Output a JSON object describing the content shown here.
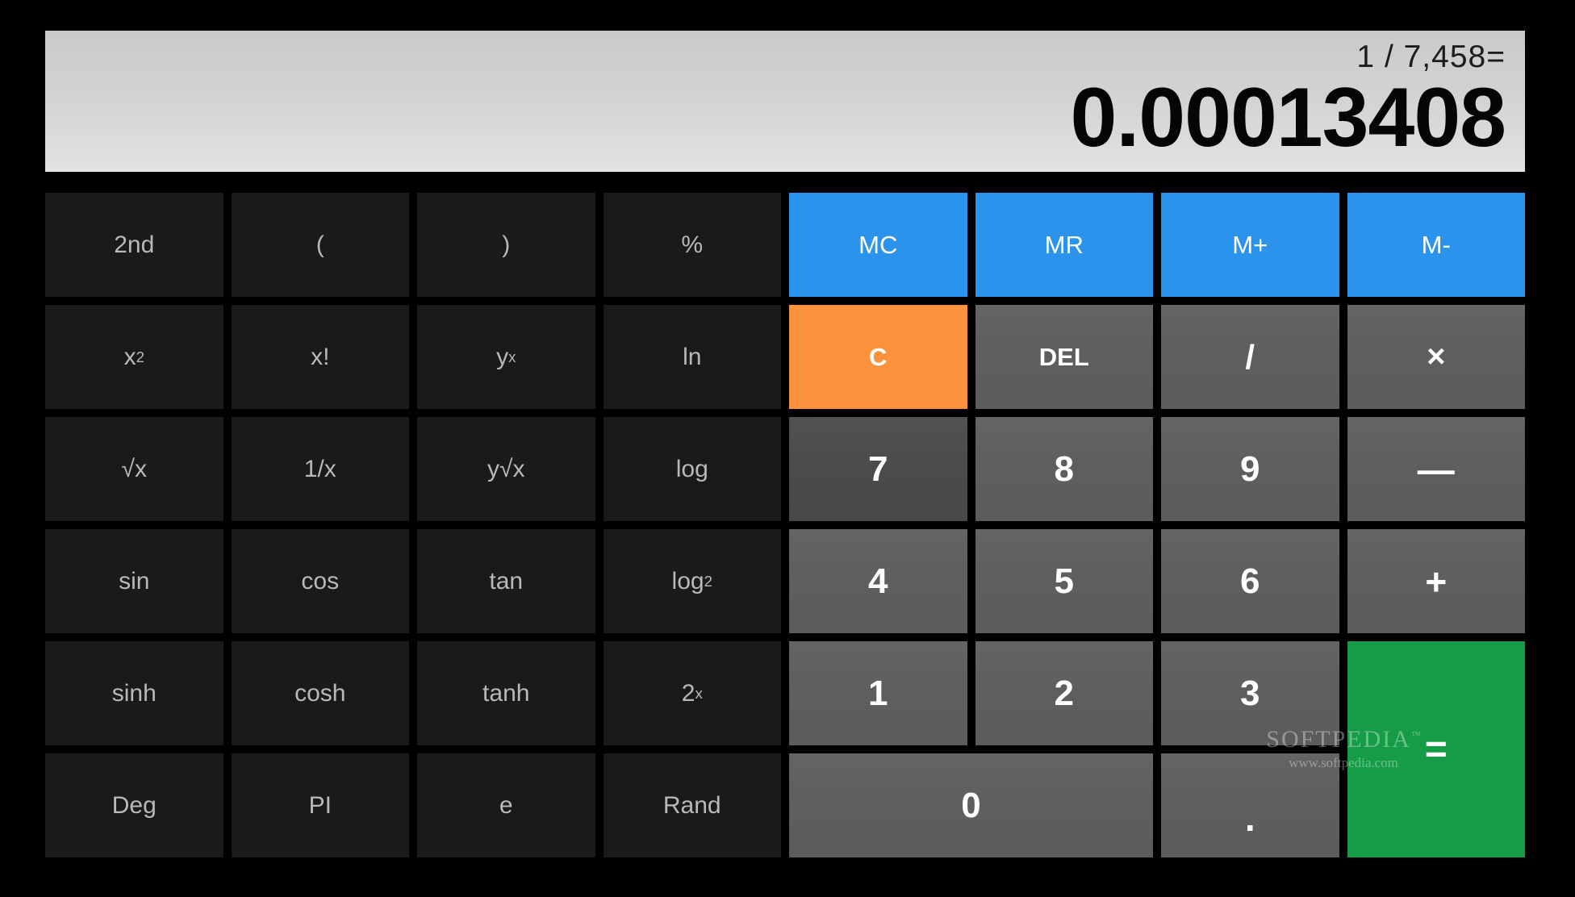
{
  "app": {
    "name": "Calculator",
    "mode": "scientific"
  },
  "display": {
    "expression": "1 / 7,458=",
    "result": "0.00013408"
  },
  "colors": {
    "background": "#000000",
    "display_top": "#cacaca",
    "display_bottom": "#e2e2e2",
    "function_key": "#1a1a1a",
    "function_text": "#b9b9b9",
    "memory_key": "#2b93eb",
    "clear_key": "#fc923b",
    "number_key": "#5e5e5e",
    "number_key_hover": "#4b4b4b",
    "equals_key": "#169b46",
    "key_text": "#ffffff"
  },
  "keys": {
    "functions": [
      {
        "id": "second",
        "label": "2nd",
        "html": "2nd"
      },
      {
        "id": "paren-open",
        "label": "(",
        "html": "("
      },
      {
        "id": "paren-close",
        "label": ")",
        "html": ")"
      },
      {
        "id": "percent",
        "label": "%",
        "html": "%"
      },
      {
        "id": "x-squared",
        "label": "x²",
        "html": "x<span class=\"sup\">2</span>"
      },
      {
        "id": "factorial",
        "label": "x!",
        "html": "x!"
      },
      {
        "id": "y-power-x",
        "label": "yˣ",
        "html": "y<span class=\"sup\">x</span>"
      },
      {
        "id": "natural-log",
        "label": "ln",
        "html": "ln"
      },
      {
        "id": "square-root",
        "label": "√x",
        "html": "√x"
      },
      {
        "id": "reciprocal",
        "label": "1/x",
        "html": "1/x"
      },
      {
        "id": "y-root-x",
        "label": "y√x",
        "html": "y√x"
      },
      {
        "id": "log10",
        "label": "log",
        "html": "log"
      },
      {
        "id": "sin",
        "label": "sin",
        "html": "sin"
      },
      {
        "id": "cos",
        "label": "cos",
        "html": "cos"
      },
      {
        "id": "tan",
        "label": "tan",
        "html": "tan"
      },
      {
        "id": "log2",
        "label": "log₂",
        "html": "log<span class=\"sub\">2</span>"
      },
      {
        "id": "sinh",
        "label": "sinh",
        "html": "sinh"
      },
      {
        "id": "cosh",
        "label": "cosh",
        "html": "cosh"
      },
      {
        "id": "tanh",
        "label": "tanh",
        "html": "tanh"
      },
      {
        "id": "two-power-x",
        "label": "2ˣ",
        "html": "2<span class=\"sup\">x</span>"
      },
      {
        "id": "degrees",
        "label": "Deg",
        "html": "Deg"
      },
      {
        "id": "pi",
        "label": "PI",
        "html": "PI"
      },
      {
        "id": "euler",
        "label": "e",
        "html": "e"
      },
      {
        "id": "random",
        "label": "Rand",
        "html": "Rand"
      }
    ],
    "memory": [
      {
        "id": "memory-clear",
        "label": "MC"
      },
      {
        "id": "memory-recall",
        "label": "MR"
      },
      {
        "id": "memory-add",
        "label": "M+"
      },
      {
        "id": "memory-subtract",
        "label": "M-"
      }
    ],
    "clear": {
      "id": "clear",
      "label": "C"
    },
    "delete": {
      "id": "delete",
      "label": "DEL"
    },
    "operators": {
      "divide": "/",
      "multiply": "×",
      "subtract": "—",
      "add": "+",
      "equals": "="
    },
    "digits": {
      "seven": "7",
      "eight": "8",
      "nine": "9",
      "four": "4",
      "five": "5",
      "six": "6",
      "one": "1",
      "two": "2",
      "three": "3",
      "zero": "0",
      "decimal": "."
    },
    "hovered_key": "7"
  },
  "watermark": {
    "name": "SOFTPEDIA",
    "trademark": "™",
    "url": "www.softpedia.com"
  }
}
